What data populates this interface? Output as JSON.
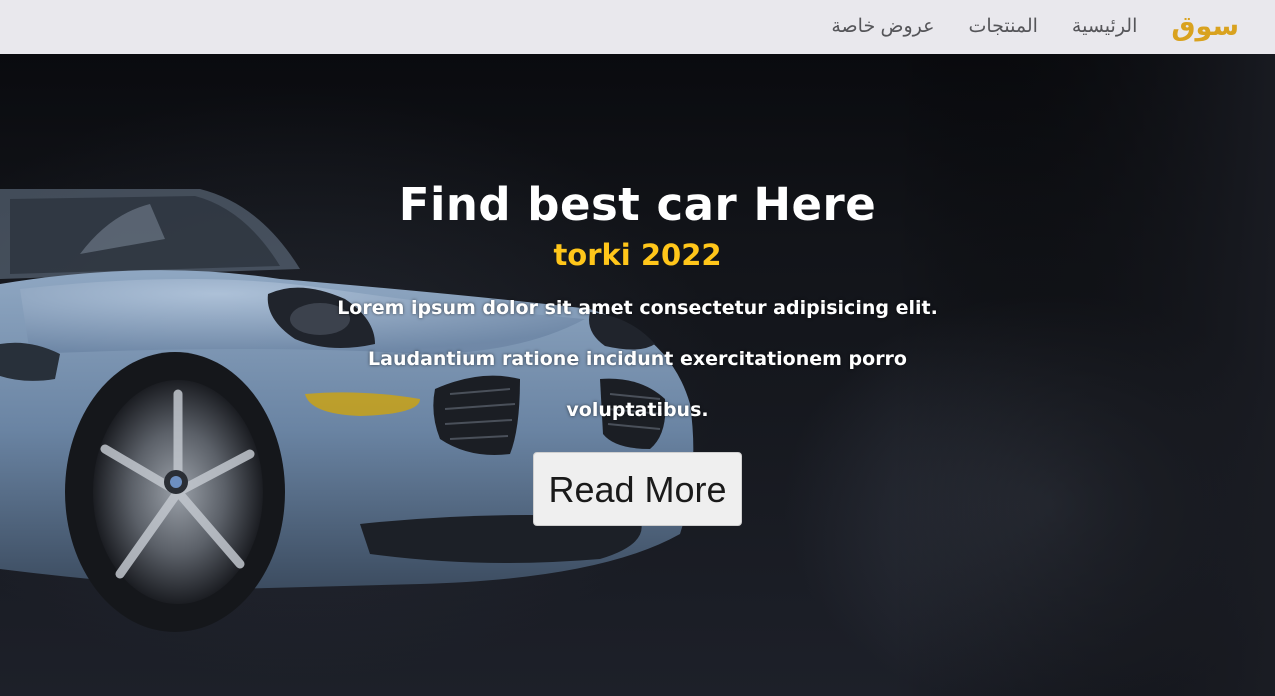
{
  "navbar": {
    "brand": "سوق",
    "links": [
      "الرئيسية",
      "المنتجات",
      "عروض خاصة"
    ]
  },
  "hero": {
    "title": "Find best car Here",
    "subtitle": "torki 2022",
    "text": "Lorem ipsum dolor sit amet consectetur adipisicing elit. Laudantium ratione incidunt exercitationem porro voluptatibus.",
    "button": "Read More",
    "image": "car-photo"
  },
  "colors": {
    "navbar_bg": "#e9e8ed",
    "brand": "#d9a21f",
    "subtitle": "#ffc61a",
    "hero_bg": "#1c1f26"
  }
}
